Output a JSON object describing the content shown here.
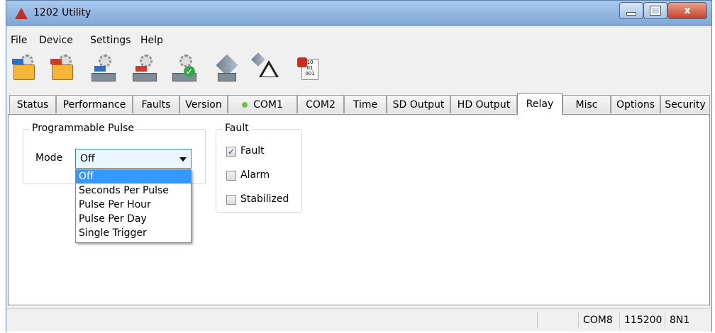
{
  "window": {
    "title": "1202 Utility",
    "close_label": "x"
  },
  "menu": [
    "File",
    "Device",
    "Settings",
    "Help"
  ],
  "toolbar_icons": [
    "open-config-icon",
    "save-config-icon",
    "read-device-icon",
    "write-device-icon",
    "verify-device-icon",
    "satellite-connect-icon",
    "warning-icon",
    "firmware-icon"
  ],
  "tabs": [
    {
      "label": "Status"
    },
    {
      "label": "Performance"
    },
    {
      "label": "Faults"
    },
    {
      "label": "Version"
    },
    {
      "label": "COM1",
      "indicator": "#6cc04a"
    },
    {
      "label": "COM2"
    },
    {
      "label": "Time"
    },
    {
      "label": "SD Output"
    },
    {
      "label": "HD Output"
    },
    {
      "label": "Relay",
      "active": true
    },
    {
      "label": "Misc"
    },
    {
      "label": "Options"
    },
    {
      "label": "Security"
    }
  ],
  "pulse_group": {
    "title": "Programmable Pulse",
    "mode_label": "Mode",
    "mode_value": "Off",
    "options": [
      "Off",
      "Seconds Per Pulse",
      "Pulse Per Hour",
      "Pulse Per Day",
      "Single Trigger"
    ],
    "selected_option": "Off"
  },
  "fault_group": {
    "title": "Fault",
    "checkboxes": [
      {
        "label": "Fault",
        "checked": true
      },
      {
        "label": "Alarm",
        "checked": false
      },
      {
        "label": "Stabilized",
        "checked": false
      }
    ]
  },
  "statusbar": {
    "port": "COM8",
    "baud": "115200",
    "format": "8N1"
  },
  "colors": {
    "selection": "#3399ff",
    "com_indicator": "#6cc04a",
    "titlebar": "#a9c8ee"
  }
}
